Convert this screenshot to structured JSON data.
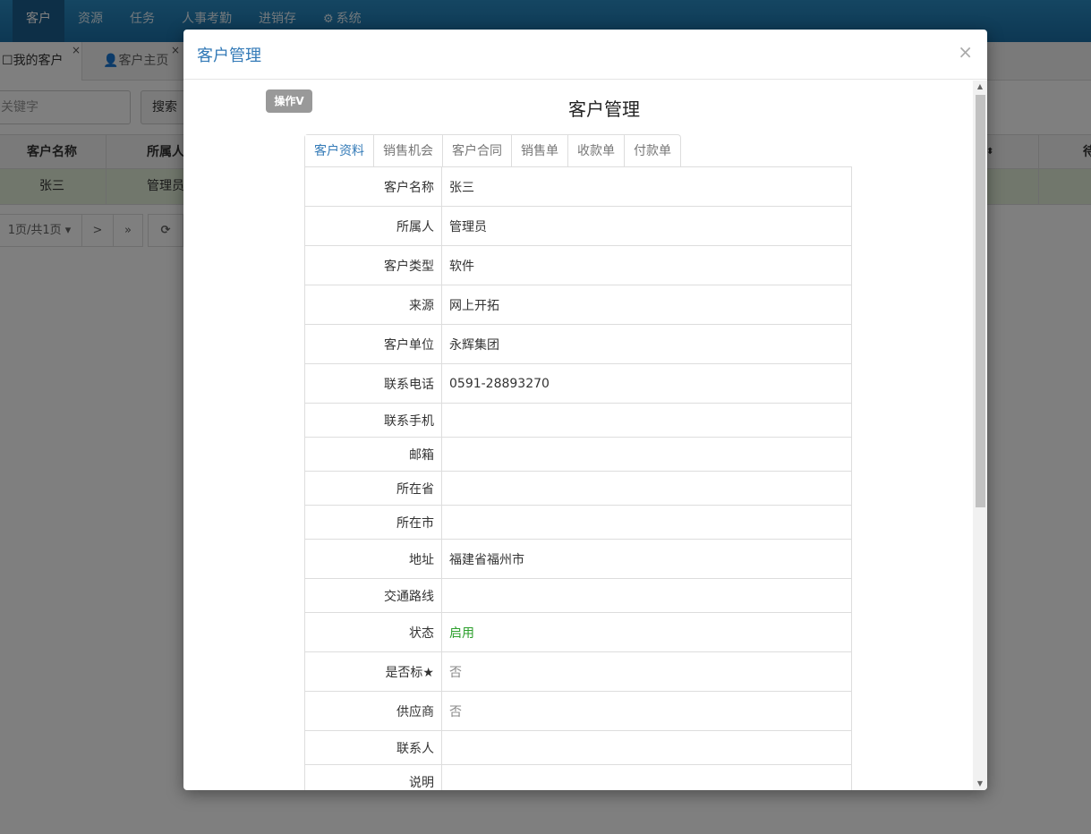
{
  "topnav": {
    "items": [
      {
        "label": "客户",
        "active": true
      },
      {
        "label": "资源"
      },
      {
        "label": "任务"
      },
      {
        "label": "人事考勤"
      },
      {
        "label": "进销存"
      },
      {
        "label": "系统"
      }
    ]
  },
  "pagetabs": {
    "items": [
      {
        "label": "我的客户",
        "close": "×"
      },
      {
        "label": "客户主页",
        "close": "×"
      }
    ]
  },
  "search": {
    "placeholder": "关键字",
    "button": "搜索"
  },
  "bg_table": {
    "headers": [
      "客户名称",
      "所属人"
    ],
    "header_partial": "待",
    "row": [
      "张三",
      "管理员"
    ]
  },
  "pager": {
    "page_info": "1页/共1页",
    "next": ">",
    "last": "»",
    "refresh": "⟳"
  },
  "modal": {
    "title": "客户管理",
    "close": "×",
    "op_button": "操作V",
    "inner_title": "客户管理",
    "tabs": [
      "客户资料",
      "销售机会",
      "客户合同",
      "销售单",
      "收款单",
      "付款单"
    ],
    "fields": [
      {
        "label": "客户名称",
        "value": "张三"
      },
      {
        "label": "所属人",
        "value": "管理员"
      },
      {
        "label": "客户类型",
        "value": "软件"
      },
      {
        "label": "来源",
        "value": "网上开拓"
      },
      {
        "label": "客户单位",
        "value": "永辉集团"
      },
      {
        "label": "联系电话",
        "value": "0591-28893270"
      },
      {
        "label": "联系手机",
        "value": ""
      },
      {
        "label": "邮箱",
        "value": ""
      },
      {
        "label": "所在省",
        "value": ""
      },
      {
        "label": "所在市",
        "value": ""
      },
      {
        "label": "地址",
        "value": "福建省福州市"
      },
      {
        "label": "交通路线",
        "value": ""
      },
      {
        "label": "状态",
        "value": "启用"
      },
      {
        "label": "是否标★",
        "value": "否"
      },
      {
        "label": "供应商",
        "value": "否"
      },
      {
        "label": "联系人",
        "value": ""
      },
      {
        "label": "说明",
        "value": ""
      }
    ]
  },
  "colors": {
    "nav": "#1a6fa6",
    "accent": "#337ab7",
    "status_green": "#2b9f2b"
  }
}
